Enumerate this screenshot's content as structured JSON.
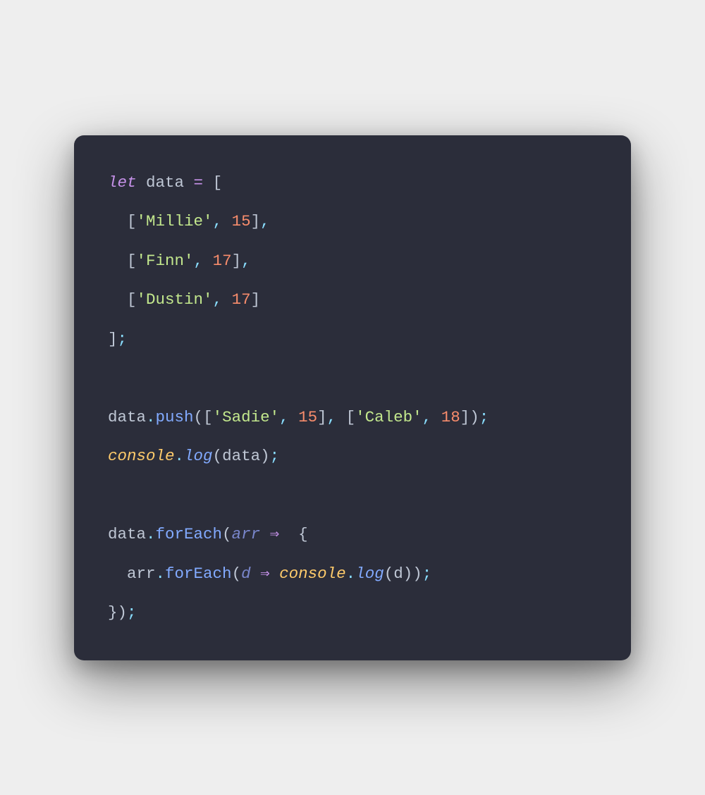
{
  "code": {
    "keyword_let": "let",
    "ident_data": "data",
    "op_assign": " = ",
    "bracket_open": "[",
    "bracket_close": "]",
    "bracket_close_semi": "];",
    "comma": ",",
    "comma_space": ", ",
    "semi": ";",
    "paren_open": "(",
    "paren_close": ")",
    "paren_close_semi": ");",
    "brace_open": " {",
    "brace_close": "}",
    "dot": ".",
    "str_millie": "'Millie'",
    "num_15": "15",
    "str_finn": "'Finn'",
    "num_17a": "17",
    "str_dustin": "'Dustin'",
    "num_17b": "17",
    "method_push": "push",
    "str_sadie": "'Sadie'",
    "num_15b": "15",
    "str_caleb": "'Caleb'",
    "num_18": "18",
    "builtin_console": "console",
    "method_log": "log",
    "method_forEach": "forEach",
    "param_arr": "arr",
    "param_d": "d",
    "arrow": " ⇒ ",
    "ident_arr": "arr",
    "indent1": "  ",
    "space": " "
  }
}
